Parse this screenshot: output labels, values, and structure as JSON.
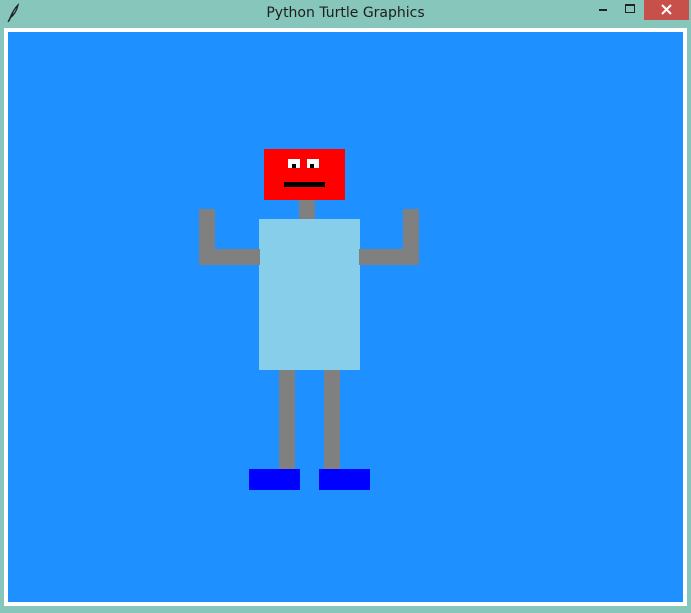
{
  "window": {
    "title": "Python Turtle Graphics",
    "app_icon": "feather-icon",
    "controls": [
      "minimize-icon",
      "maximize-icon",
      "close-icon"
    ]
  },
  "canvas": {
    "background_color": "#1e90ff",
    "robot": {
      "head_color": "#ff0000",
      "eye_color": "#ffffff",
      "pupil_color": "#000000",
      "mouth_color": "#000000",
      "neck_color": "#808080",
      "body_color": "#87ceeb",
      "arm_color": "#808080",
      "leg_color": "#808080",
      "foot_color": "#0000ff"
    }
  }
}
